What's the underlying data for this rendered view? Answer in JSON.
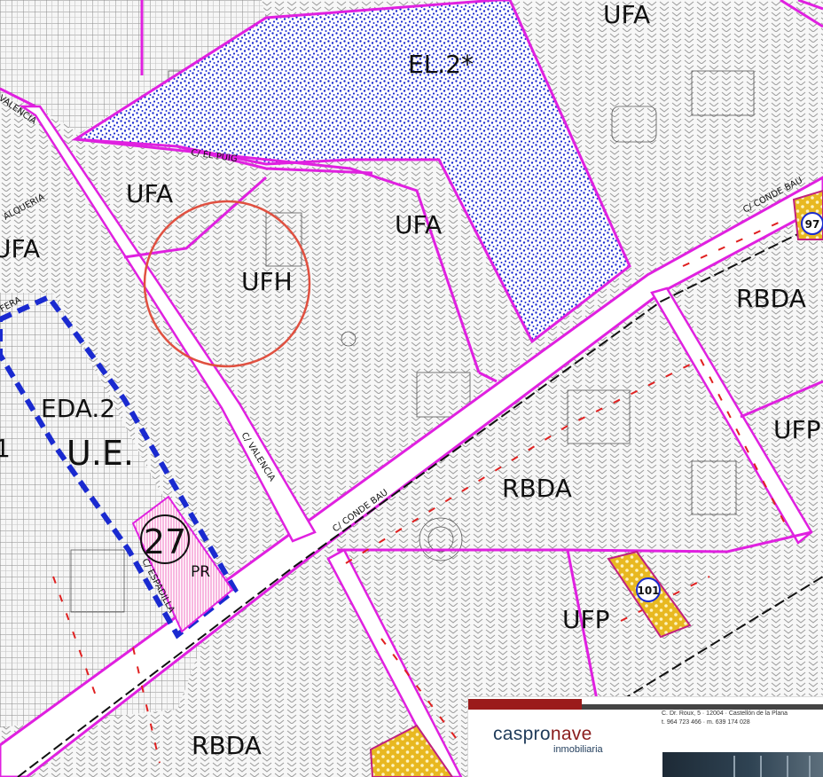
{
  "map": {
    "zones": [
      {
        "id": "el2",
        "label": "EL.2*"
      },
      {
        "id": "ufa-top-right",
        "label": "UFA"
      },
      {
        "id": "ufa-left-center",
        "label": "UFA"
      },
      {
        "id": "ufa-center",
        "label": "UFA"
      },
      {
        "id": "ufa-far-left",
        "label": "UFA"
      },
      {
        "id": "ufh",
        "label": "UFH"
      },
      {
        "id": "rbda-right",
        "label": "RBDA"
      },
      {
        "id": "rbda-center",
        "label": "RBDA"
      },
      {
        "id": "rbda-bottom",
        "label": "RBDA"
      },
      {
        "id": "ufp",
        "label": "UFP"
      },
      {
        "id": "ufp-edge",
        "label": "UFP"
      },
      {
        "id": "eda2",
        "label": "EDA.2"
      },
      {
        "id": "ue",
        "label": "U.E."
      },
      {
        "id": "edge-digit",
        "label": "1"
      },
      {
        "id": "pr",
        "label": "PR"
      }
    ],
    "unit_number": "27",
    "markers": [
      {
        "id": "marker-97",
        "label": "97"
      },
      {
        "id": "marker-101",
        "label": "101"
      }
    ],
    "streets": [
      {
        "id": "conde-bau-upper",
        "label": "C/ CONDE BAU"
      },
      {
        "id": "conde-bau-main",
        "label": "C/ CONDE BAU"
      },
      {
        "id": "valencia-lower",
        "label": "C/ VALENCIA"
      },
      {
        "id": "valencia-upper",
        "label": "VALENCIA"
      },
      {
        "id": "el-puig",
        "label": "C/ EL PUIG"
      },
      {
        "id": "espadilla",
        "label": "C/ ESPADILLA"
      },
      {
        "id": "algueria",
        "label": "ALQUERIA"
      },
      {
        "id": "small-left",
        "label": "FERA"
      }
    ],
    "colors": {
      "zone_border": "#e020e0",
      "green_space": "#1a2ad0",
      "highlight_circle": "#e05040",
      "unit_border": "#1a2ad0",
      "protected_hatch": "#f070c0",
      "marker_fill": "#e8b820",
      "marker_border": "#c02080",
      "alignment": "#e02020"
    }
  },
  "ad": {
    "brand_prefix": "caspro",
    "brand_suffix": "nave",
    "brand_sub": "inmobiliaria",
    "address_line1": "C. Dr. Roux, 5 · 12004 · Castellón de la Plana",
    "address_line2": "t. 964 723 466 · m. 639 174 028"
  }
}
